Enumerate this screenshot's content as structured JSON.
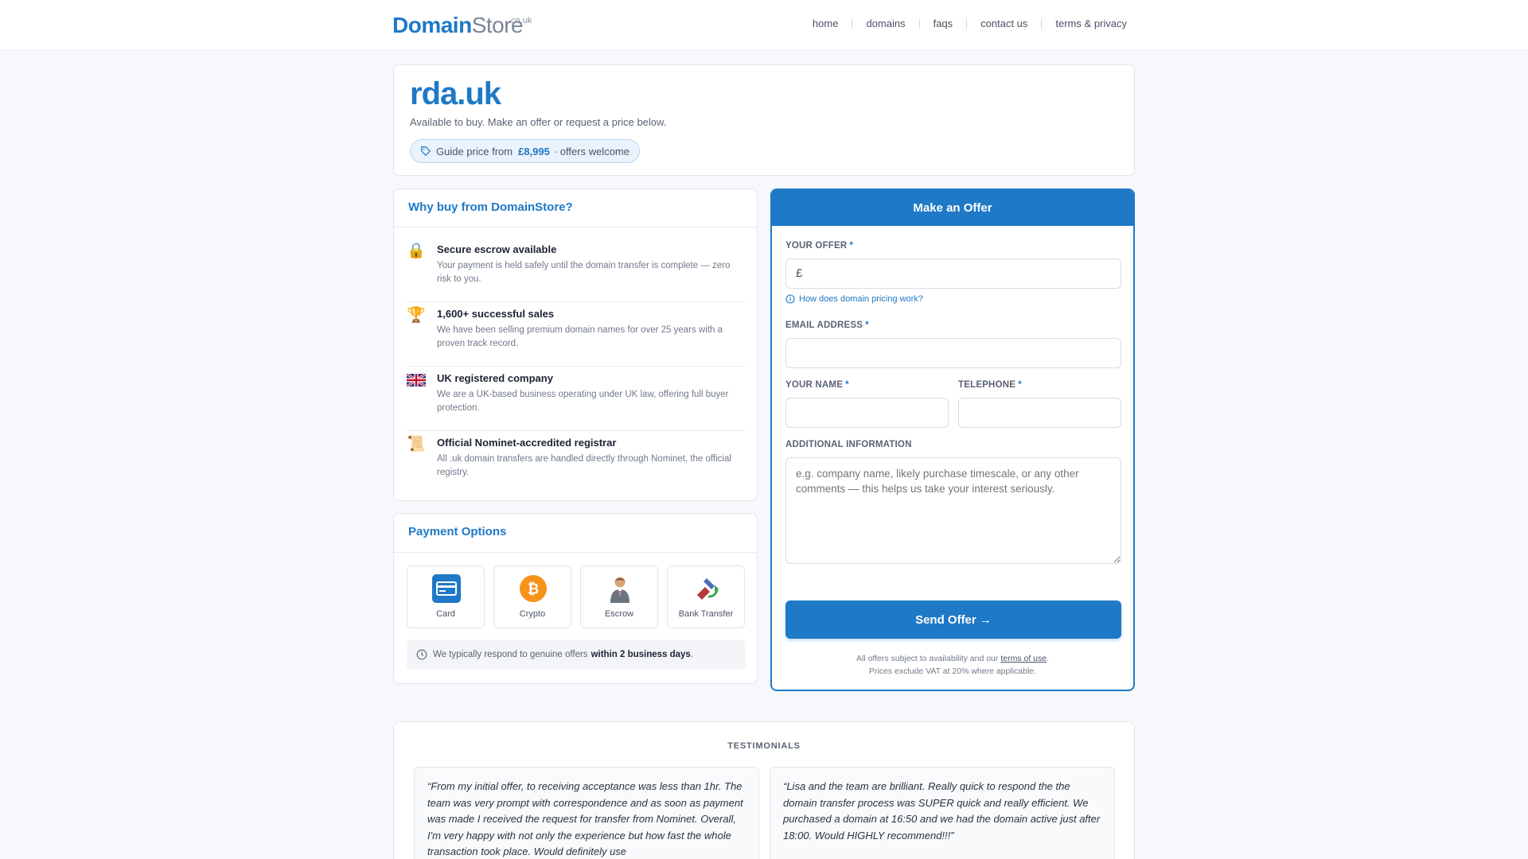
{
  "header": {
    "logo_main": "Domain",
    "logo_store": "Store",
    "logo_tld": ".co.uk",
    "nav": [
      "home",
      "domains",
      "faqs",
      "contact us",
      "terms & privacy"
    ]
  },
  "hero": {
    "domain": "rda.uk",
    "subtitle": "Available to buy. Make an offer or request a price below.",
    "guide_prefix": "Guide price from",
    "guide_price": "£8,995",
    "guide_suffix": "· offers welcome"
  },
  "why": {
    "title": "Why buy from DomainStore?",
    "items": [
      {
        "icon": "lock-icon",
        "title": "Secure escrow available",
        "desc": "Your payment is held safely until the domain transfer is complete — zero risk to you."
      },
      {
        "icon": "trophy-icon",
        "title": "1,600+ successful sales",
        "desc": "We have been selling premium domain names for over 25 years with a proven track record."
      },
      {
        "icon": "uk-flag-icon",
        "title": "UK registered company",
        "desc": "We are a UK-based business operating under UK law, offering full buyer protection."
      },
      {
        "icon": "scroll-icon",
        "title": "Official Nominet-accredited registrar",
        "desc": "All .uk domain transfers are handled directly through Nominet, the official registry."
      }
    ]
  },
  "payment": {
    "title": "Payment Options",
    "options": [
      {
        "icon": "card-icon",
        "label": "Card"
      },
      {
        "icon": "bitcoin-icon",
        "label": "Crypto"
      },
      {
        "icon": "escrow-person-icon",
        "label": "Escrow"
      },
      {
        "icon": "bank-transfer-icon",
        "label": "Bank Transfer"
      }
    ],
    "note_prefix": "We typically respond to genuine offers",
    "note_bold": "within 2 business days",
    "note_suffix": "."
  },
  "offer": {
    "title": "Make an Offer",
    "offer_label": "YOUR OFFER",
    "currency": "£",
    "help_link": "How does domain pricing work?",
    "email_label": "EMAIL ADDRESS",
    "name_label": "YOUR NAME",
    "phone_label": "TELEPHONE",
    "info_label": "ADDITIONAL INFORMATION",
    "info_placeholder": "e.g. company name, likely purchase timescale, or any other comments — this helps us take your interest seriously.",
    "required_mark": "*",
    "send_label": "Send Offer →",
    "fine_prefix": "All offers subject to availability and our",
    "fine_link": "terms of use",
    "fine_suffix": ".",
    "fine_line2": "Prices exclude VAT at 20% where applicable."
  },
  "testimonials": {
    "heading": "TESTIMONIALS",
    "quotes": [
      "“From my initial offer, to receiving acceptance was less than 1hr. The team was very prompt with correspondence and as soon as payment was made I received the request for transfer from Nominet. Overall, I'm very happy with not only the experience but how fast the whole transaction took place. Would definitely use",
      "“Lisa and the team are brilliant. Really quick to respond the the domain transfer process was SUPER quick and really efficient. We purchased a domain at 16:50 and we had the domain active just after 18:00. Would HIGHLY recommend!!!”"
    ]
  },
  "colors": {
    "accent": "#1e79c7",
    "background": "#f6f8fb"
  }
}
